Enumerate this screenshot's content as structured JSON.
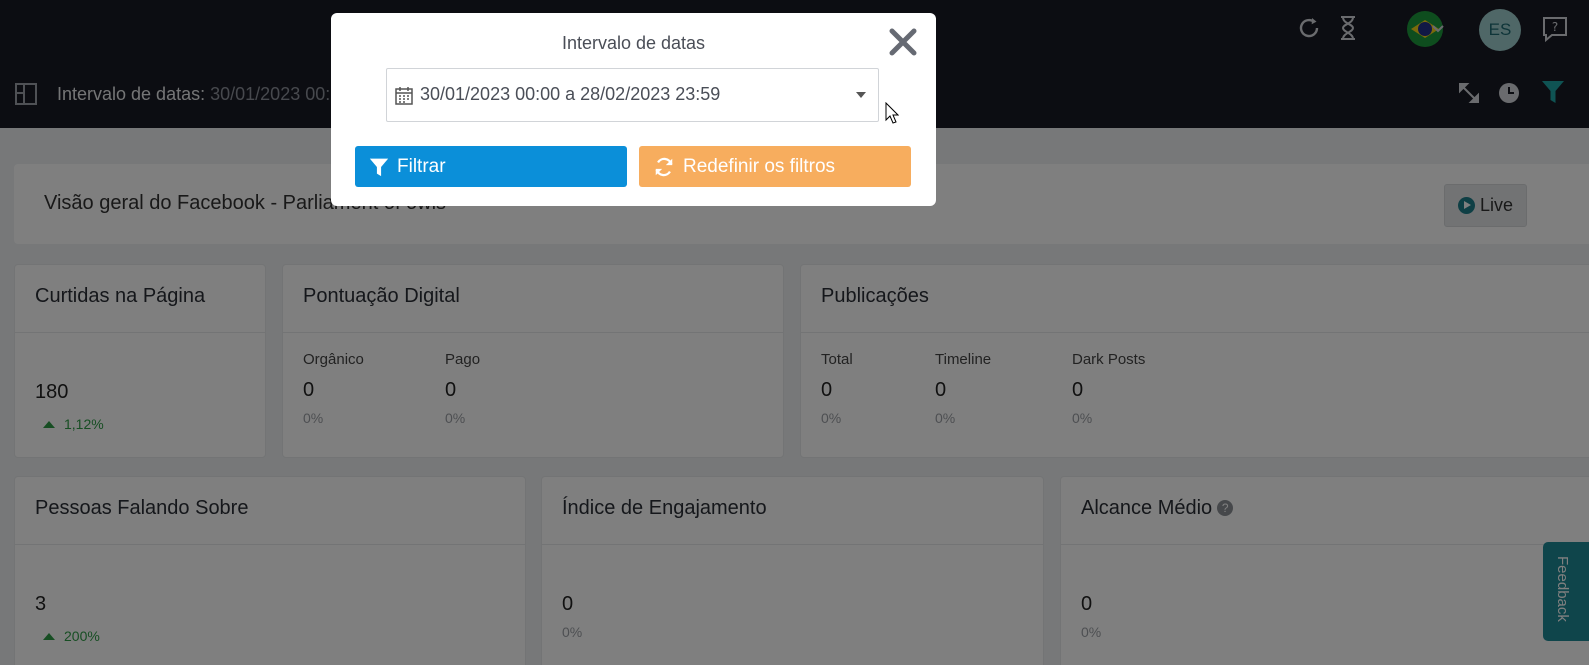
{
  "topbar": {
    "icons": [
      "refresh-icon",
      "hourglass-icon",
      "brazil-flag",
      "chevron-down-icon",
      "help-chat-icon"
    ],
    "avatar_initials": "ES"
  },
  "subbar": {
    "label": "Intervalo de datas",
    "value": "30/01/2023 00:",
    "icons": [
      "panel-toggle-icon",
      "expand-icon",
      "clock-icon",
      "filter-icon"
    ],
    "filter_color": "#1fa6a6"
  },
  "overview": {
    "title": "Visão geral do Facebook - Parliament of owls",
    "live_label": "Live"
  },
  "cards": {
    "likes": {
      "title": "Curtidas na Página",
      "value": "180",
      "change": "1,12%"
    },
    "digital_score": {
      "title": "Pontuação Digital",
      "cols": [
        {
          "label": "Orgânico",
          "value": "0",
          "pct": "0%"
        },
        {
          "label": "Pago",
          "value": "0",
          "pct": "0%"
        }
      ]
    },
    "publications": {
      "title": "Publicações",
      "cols": [
        {
          "label": "Total",
          "value": "0",
          "pct": "0%"
        },
        {
          "label": "Timeline",
          "value": "0",
          "pct": "0%"
        },
        {
          "label": "Dark Posts",
          "value": "0",
          "pct": "0%"
        }
      ]
    },
    "talking": {
      "title": "Pessoas Falando Sobre",
      "value": "3",
      "change": "200%"
    },
    "engagement": {
      "title": "Índice de Engajamento",
      "value": "0",
      "pct": "0%"
    },
    "reach": {
      "title": "Alcance Médio",
      "value": "0",
      "pct": "0%",
      "help": "?"
    }
  },
  "feedback_tab": "Feedback",
  "modal": {
    "title": "Intervalo de datas",
    "date_range": "30/01/2023 00:00 a 28/02/2023 23:59",
    "filter_button": "Filtrar",
    "reset_button": "Redefinir os filtros",
    "filter_color": "#0b8fd9",
    "reset_color": "#f7ad5e"
  }
}
